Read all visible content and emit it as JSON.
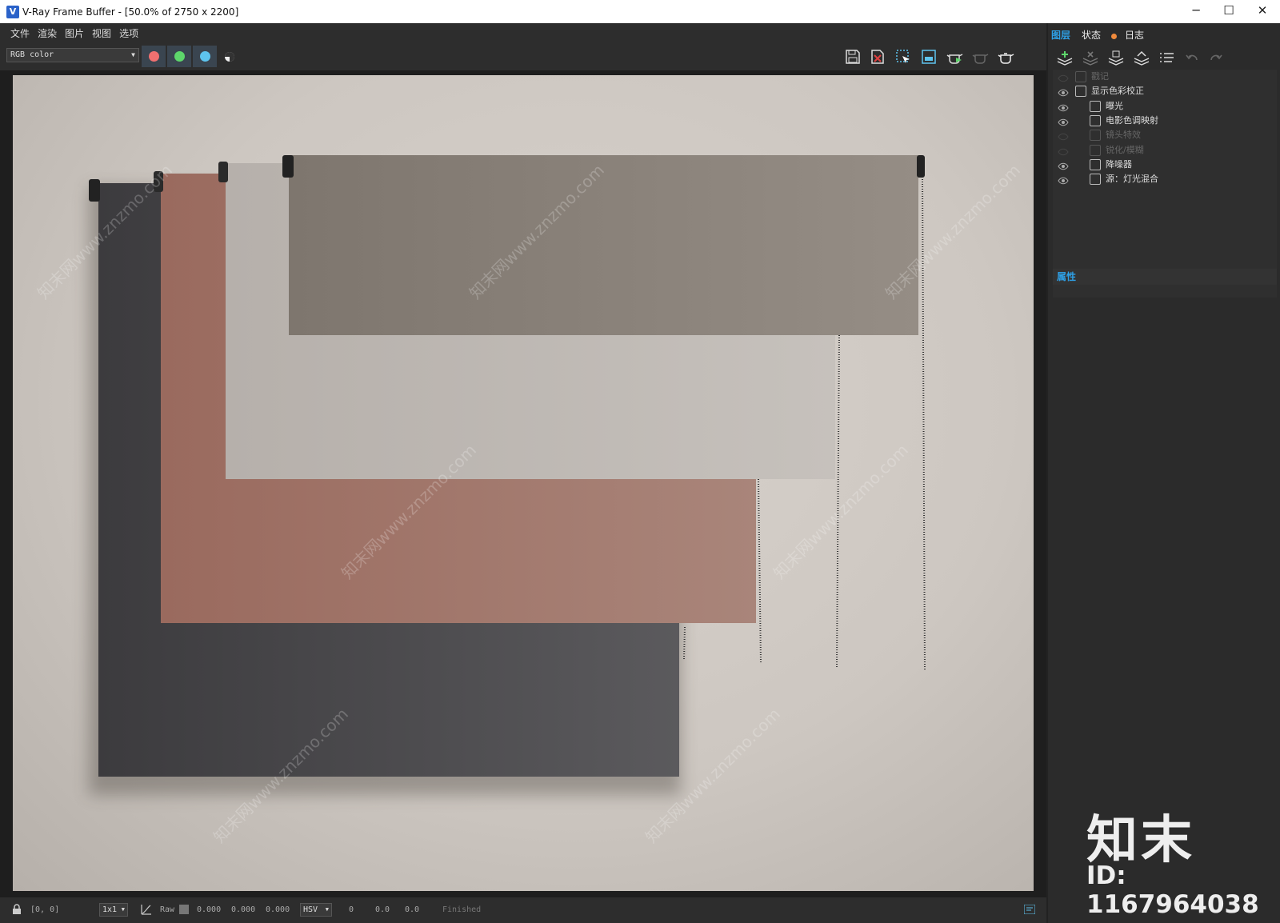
{
  "window": {
    "title": "V-Ray Frame Buffer - [50.0% of 2750 x 2200]",
    "minimize": "─",
    "maximize": "☐",
    "close": "✕"
  },
  "menu": [
    "文件",
    "渲染",
    "图片",
    "视图",
    "选项"
  ],
  "toolbar": {
    "channel": "RGB color",
    "channel_buttons": [
      {
        "name": "red-channel-button",
        "color": "#f07070"
      },
      {
        "name": "green-channel-button",
        "color": "#5dd66b"
      },
      {
        "name": "blue-channel-button",
        "color": "#5ec4ee"
      }
    ]
  },
  "statusbar": {
    "coords": "[0, 0]",
    "zoom": "1x1",
    "mode": "Raw",
    "values": [
      "0.000",
      "0.000",
      "0.000"
    ],
    "colorspace": "HSV",
    "hsv": [
      "0",
      "0.0",
      "0.0"
    ],
    "status": "Finished"
  },
  "panel": {
    "tabs": [
      "图层",
      "状态",
      "日志"
    ],
    "layers": [
      {
        "label": "戳记",
        "visible": false,
        "indent": 0
      },
      {
        "label": "显示色彩校正",
        "visible": true,
        "indent": 0
      },
      {
        "label": "曝光",
        "visible": true,
        "indent": 1
      },
      {
        "label": "电影色调映射",
        "visible": true,
        "indent": 1
      },
      {
        "label": "镜头特效",
        "visible": false,
        "indent": 1
      },
      {
        "label": "锐化/模糊",
        "visible": false,
        "indent": 1
      },
      {
        "label": "降噪器",
        "visible": true,
        "indent": 1
      },
      {
        "label": "源：灯光混合",
        "visible": true,
        "indent": 1
      }
    ],
    "properties_title": "属性"
  },
  "watermark": {
    "brand": "知末",
    "id": "ID: 1167964038",
    "site": "知末网www.znzmo.com"
  }
}
